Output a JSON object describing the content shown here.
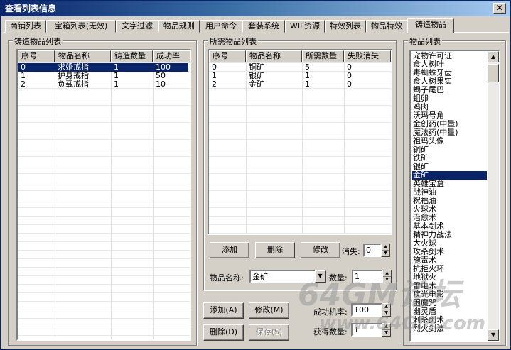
{
  "window": {
    "title": "查看列表信息",
    "close_glyph": "✕"
  },
  "tabs": [
    "商铺列表",
    "宝箱列表(无效)",
    "文字过滤",
    "物品规则",
    "用户命令",
    "套装系统",
    "WIL资源",
    "特效列表",
    "物品特效",
    "铸造物品"
  ],
  "forge_list": {
    "legend": "铸造物品列表",
    "columns": [
      "序号",
      "物品名称",
      "铸造数量",
      "成功率"
    ],
    "rows": [
      [
        "0",
        "求婚戒指",
        "1",
        "100"
      ],
      [
        "1",
        "护身戒指",
        "1",
        "50"
      ],
      [
        "2",
        "负载戒指",
        "1",
        "10"
      ]
    ]
  },
  "required_list": {
    "legend": "所需物品列表",
    "columns": [
      "序号",
      "物品名称",
      "所需数量",
      "失败消失"
    ],
    "rows": [
      [
        "0",
        "铜矿",
        "5",
        "0"
      ],
      [
        "1",
        "银矿",
        "1",
        "0"
      ],
      [
        "2",
        "金矿",
        "1",
        "0"
      ]
    ],
    "add_label": "添加",
    "delete_label": "删除",
    "modify_label": "修改",
    "vanish_label": "消失:",
    "vanish_value": "0",
    "item_name_label": "物品名称:",
    "item_name_value": "金矿",
    "quantity_label": "数量:",
    "quantity_value": "1"
  },
  "bottom": {
    "add_label": "添加(A)",
    "modify_label": "修改(M)",
    "delete_label": "删除(D)",
    "save_label": "保存(S)",
    "success_rate_label": "成功机率:",
    "success_rate_value": "100",
    "get_quantity_label": "获得数量:",
    "get_quantity_value": "1"
  },
  "item_list": {
    "legend": "物品列表",
    "items": [
      "宠物许可证",
      "食人树叶",
      "毒蜘蛛牙齿",
      "食人树果实",
      "蝎子尾巴",
      "蛆卵",
      "鸡肉",
      "沃玛号角",
      "金创药(中量)",
      "魔法药(中量)",
      "祖玛头像",
      "铜矿",
      "铁矿",
      "银矿",
      "金矿",
      "英雄宝盒",
      "战神油",
      "祝福油",
      "火球术",
      "治愈术",
      "基本剑术",
      "精神力战法",
      "大火球",
      "攻杀剑术",
      "施毒术",
      "抗拒火环",
      "地狱火",
      "雷电术",
      "疾光电影",
      "困魔咒",
      "幽灵盾",
      "刺杀剑术",
      "烈火剑法"
    ],
    "selected_index": 14
  },
  "watermark": {
    "main": "64GM论坛",
    "url": "www.64GM.com"
  },
  "icons": {
    "spin_up": "▲",
    "spin_down": "▼",
    "combo_arrow": "▼",
    "scroll_up": "▲",
    "scroll_down": "▼"
  },
  "colors": {
    "selection": "#0a246a",
    "titlebar": "#0a246a",
    "face": "#d4d0c8"
  }
}
